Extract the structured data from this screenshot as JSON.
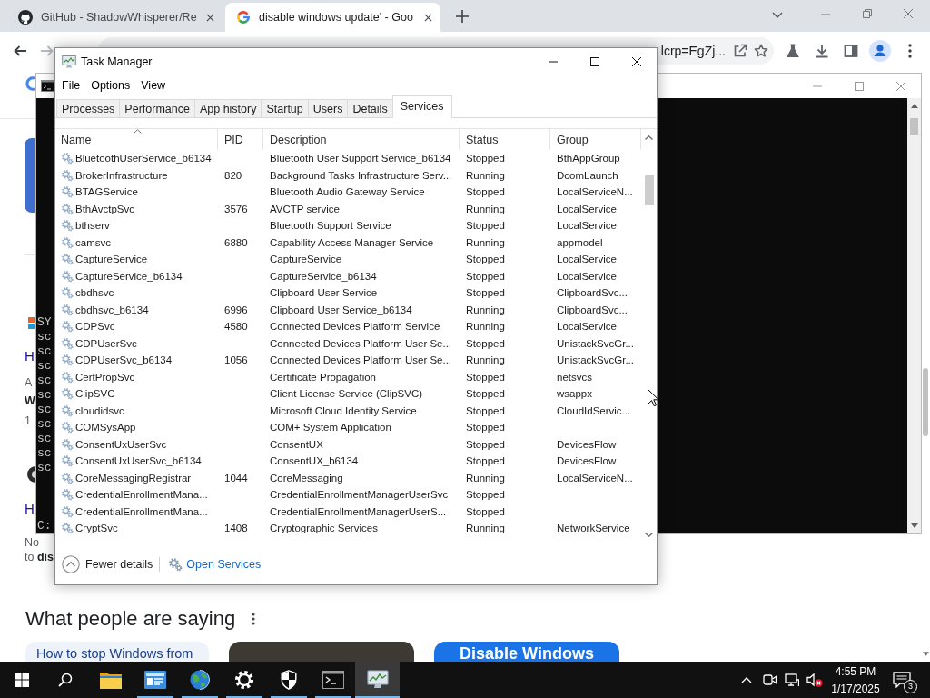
{
  "browser": {
    "tabs": [
      {
        "title": "GitHub - ShadowWhisperer/Re",
        "kind": "github",
        "selected": false
      },
      {
        "title": "disable windows update' - Goo",
        "kind": "google",
        "selected": true
      }
    ],
    "nav": {
      "back_enabled": true,
      "forward_enabled": false
    },
    "address_bar": {
      "value": "lcrp=EgZj..."
    },
    "results": [
      {
        "kind": "image"
      },
      {
        "kind": "favicon"
      },
      {
        "kind": "link",
        "text": "H"
      },
      {
        "kind": "plain",
        "text": "A"
      },
      {
        "kind": "bold",
        "text": "W"
      },
      {
        "kind": "plain",
        "text": "1"
      },
      {
        "kind": "avatar"
      },
      {
        "kind": "link",
        "text": "H"
      },
      {
        "kind": "plain",
        "text": "No"
      },
      {
        "kind": "plain",
        "text": "to **dis**"
      }
    ],
    "section_title": "What people are saying",
    "cards": [
      {
        "kind": "text",
        "text": "How to stop Windows from"
      },
      {
        "kind": "photo"
      },
      {
        "kind": "banner",
        "text": "Disable Windows"
      }
    ]
  },
  "console": {
    "output": [
      "SY",
      "sc",
      "sc",
      "sc",
      "sc",
      "sc",
      "sc",
      "sc",
      "sc",
      "sc",
      "sc"
    ],
    "prompt": "C:"
  },
  "task_manager": {
    "title": "Task Manager",
    "menu": [
      "File",
      "Options",
      "View"
    ],
    "tabs": [
      {
        "label": "Processes",
        "selected": false
      },
      {
        "label": "Performance",
        "selected": false
      },
      {
        "label": "App history",
        "selected": false
      },
      {
        "label": "Startup",
        "selected": false
      },
      {
        "label": "Users",
        "selected": false
      },
      {
        "label": "Details",
        "selected": false
      },
      {
        "label": "Services",
        "selected": true
      }
    ],
    "columns": [
      {
        "label": "Name",
        "sorted": true
      },
      {
        "label": "PID",
        "sorted": false
      },
      {
        "label": "Description",
        "sorted": false
      },
      {
        "label": "Status",
        "sorted": false
      },
      {
        "label": "Group",
        "sorted": false
      }
    ],
    "rows": [
      {
        "name": "BluetoothUserService_b6134",
        "description": "Bluetooth User Support Service_b6134",
        "status": "Stopped",
        "group": "BthAppGroup"
      },
      {
        "name": "BrokerInfrastructure",
        "pid": "820",
        "description": "Background Tasks Infrastructure Serv...",
        "status": "Running",
        "group": "DcomLaunch"
      },
      {
        "name": "BTAGService",
        "description": "Bluetooth Audio Gateway Service",
        "status": "Stopped",
        "group": "LocalServiceN..."
      },
      {
        "name": "BthAvctpSvc",
        "pid": "3576",
        "description": "AVCTP service",
        "status": "Running",
        "group": "LocalService"
      },
      {
        "name": "bthserv",
        "description": "Bluetooth Support Service",
        "status": "Stopped",
        "group": "LocalService"
      },
      {
        "name": "camsvc",
        "pid": "6880",
        "description": "Capability Access Manager Service",
        "status": "Running",
        "group": "appmodel"
      },
      {
        "name": "CaptureService",
        "description": "CaptureService",
        "status": "Stopped",
        "group": "LocalService"
      },
      {
        "name": "CaptureService_b6134",
        "description": "CaptureService_b6134",
        "status": "Stopped",
        "group": "LocalService"
      },
      {
        "name": "cbdhsvc",
        "description": "Clipboard User Service",
        "status": "Stopped",
        "group": "ClipboardSvc..."
      },
      {
        "name": "cbdhsvc_b6134",
        "pid": "6996",
        "description": "Clipboard User Service_b6134",
        "status": "Running",
        "group": "ClipboardSvc..."
      },
      {
        "name": "CDPSvc",
        "pid": "4580",
        "description": "Connected Devices Platform Service",
        "status": "Running",
        "group": "LocalService"
      },
      {
        "name": "CDPUserSvc",
        "description": "Connected Devices Platform User Se...",
        "status": "Stopped",
        "group": "UnistackSvcGr..."
      },
      {
        "name": "CDPUserSvc_b6134",
        "pid": "1056",
        "description": "Connected Devices Platform User Se...",
        "status": "Running",
        "group": "UnistackSvcGr..."
      },
      {
        "name": "CertPropSvc",
        "description": "Certificate Propagation",
        "status": "Stopped",
        "group": "netsvcs"
      },
      {
        "name": "ClipSVC",
        "description": "Client License Service (ClipSVC)",
        "status": "Stopped",
        "group": "wsappx"
      },
      {
        "name": "cloudidsvc",
        "description": "Microsoft Cloud Identity Service",
        "status": "Stopped",
        "group": "CloudIdServic..."
      },
      {
        "name": "COMSysApp",
        "description": "COM+ System Application",
        "status": "Stopped"
      },
      {
        "name": "ConsentUxUserSvc",
        "description": "ConsentUX",
        "status": "Stopped",
        "group": "DevicesFlow"
      },
      {
        "name": "ConsentUxUserSvc_b6134",
        "description": "ConsentUX_b6134",
        "status": "Stopped",
        "group": "DevicesFlow"
      },
      {
        "name": "CoreMessagingRegistrar",
        "pid": "1044",
        "description": "CoreMessaging",
        "status": "Running",
        "group": "LocalServiceN..."
      },
      {
        "name": "CredentialEnrollmentMana...",
        "description": "CredentialEnrollmentManagerUserSvc",
        "status": "Stopped"
      },
      {
        "name": "CredentialEnrollmentMana...",
        "description": "CredentialEnrollmentManagerUserS...",
        "status": "Stopped"
      },
      {
        "name": "CryptSvc",
        "pid": "1408",
        "description": "Cryptographic Services",
        "status": "Running",
        "group": "NetworkService"
      }
    ],
    "footer": {
      "fewer_details": "Fewer details",
      "open_services": "Open Services"
    }
  },
  "taskbar": {
    "apps": [
      {
        "kind": "folder",
        "running": false,
        "active": false
      },
      {
        "kind": "info",
        "running": true,
        "active": false
      },
      {
        "kind": "globe",
        "running": true,
        "active": false
      },
      {
        "kind": "gear",
        "running": true,
        "active": false
      },
      {
        "kind": "shield",
        "running": true,
        "active": false
      },
      {
        "kind": "terminal",
        "running": true,
        "active": false
      },
      {
        "kind": "monitor",
        "running": true,
        "active": true
      }
    ],
    "volume": {
      "muted": true
    },
    "time": "4:55 PM",
    "date": "1/17/2025",
    "notification_count": "3"
  }
}
